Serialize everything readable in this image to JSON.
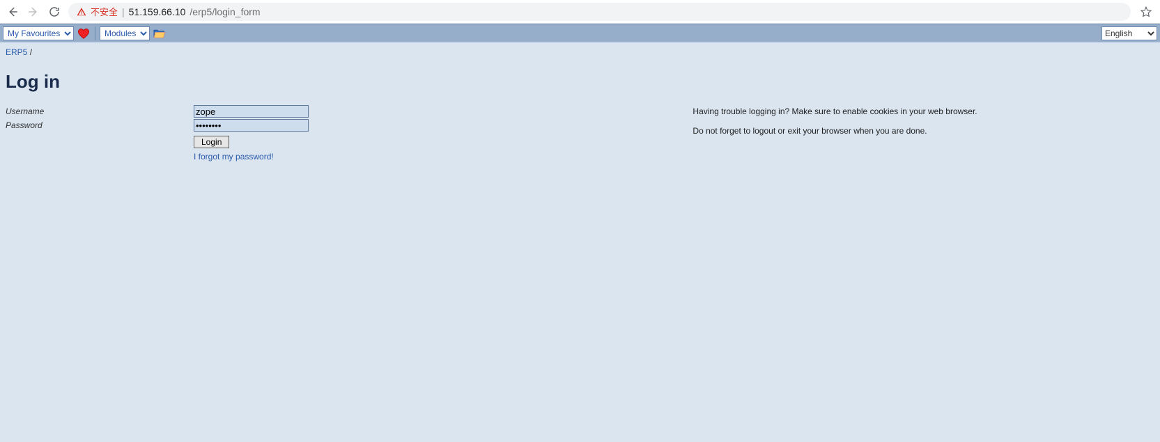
{
  "browser": {
    "insecure_label": "不安全",
    "url_host": "51.159.66.10",
    "url_path": "/erp5/login_form"
  },
  "toolbar": {
    "favourites_label": "My Favourites",
    "modules_label": "Modules",
    "language_selected": "English"
  },
  "breadcrumb": {
    "root": "ERP5",
    "sep": "/"
  },
  "page": {
    "title": "Log in"
  },
  "form": {
    "username_label": "Username",
    "username_value": "zope",
    "password_label": "Password",
    "password_value": "••••••••",
    "login_button": "Login",
    "forgot_link": "I forgot my password!"
  },
  "help": {
    "line1": "Having trouble logging in? Make sure to enable cookies in your web browser.",
    "line2": "Do not forget to logout or exit your browser when you are done."
  }
}
